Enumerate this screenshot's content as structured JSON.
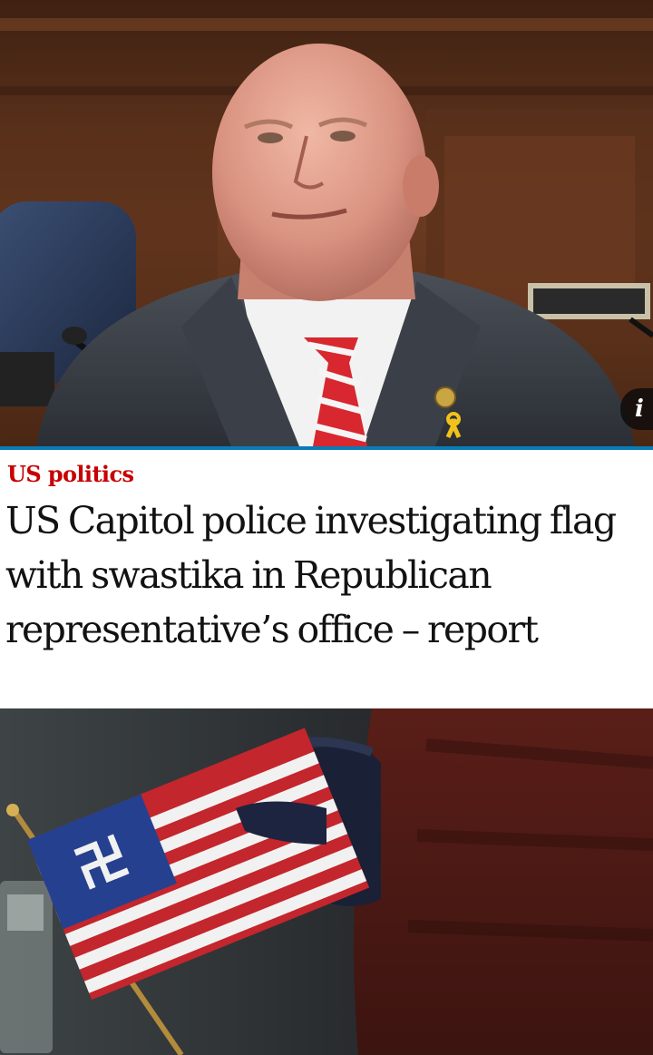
{
  "lead_image": {
    "alt_subject": "man-in-suit-at-hearing",
    "info_icon": "i",
    "colors": {
      "wood_panel": "#5b311c",
      "suit": "#3a3f47",
      "tie_red": "#d8272f"
    }
  },
  "article": {
    "section": "US politics",
    "headline": "US Capitol police investigating flag with swastika in Republican representative’s office – report",
    "colors": {
      "section_red": "#c70000",
      "divider_blue": "#0a7bb7"
    }
  },
  "second_image": {
    "alt_subject": "gloved-hand-holding-small-flag-with-swastika",
    "colors": {
      "flag_blue": "#25408f",
      "flag_red": "#c3262c"
    }
  }
}
